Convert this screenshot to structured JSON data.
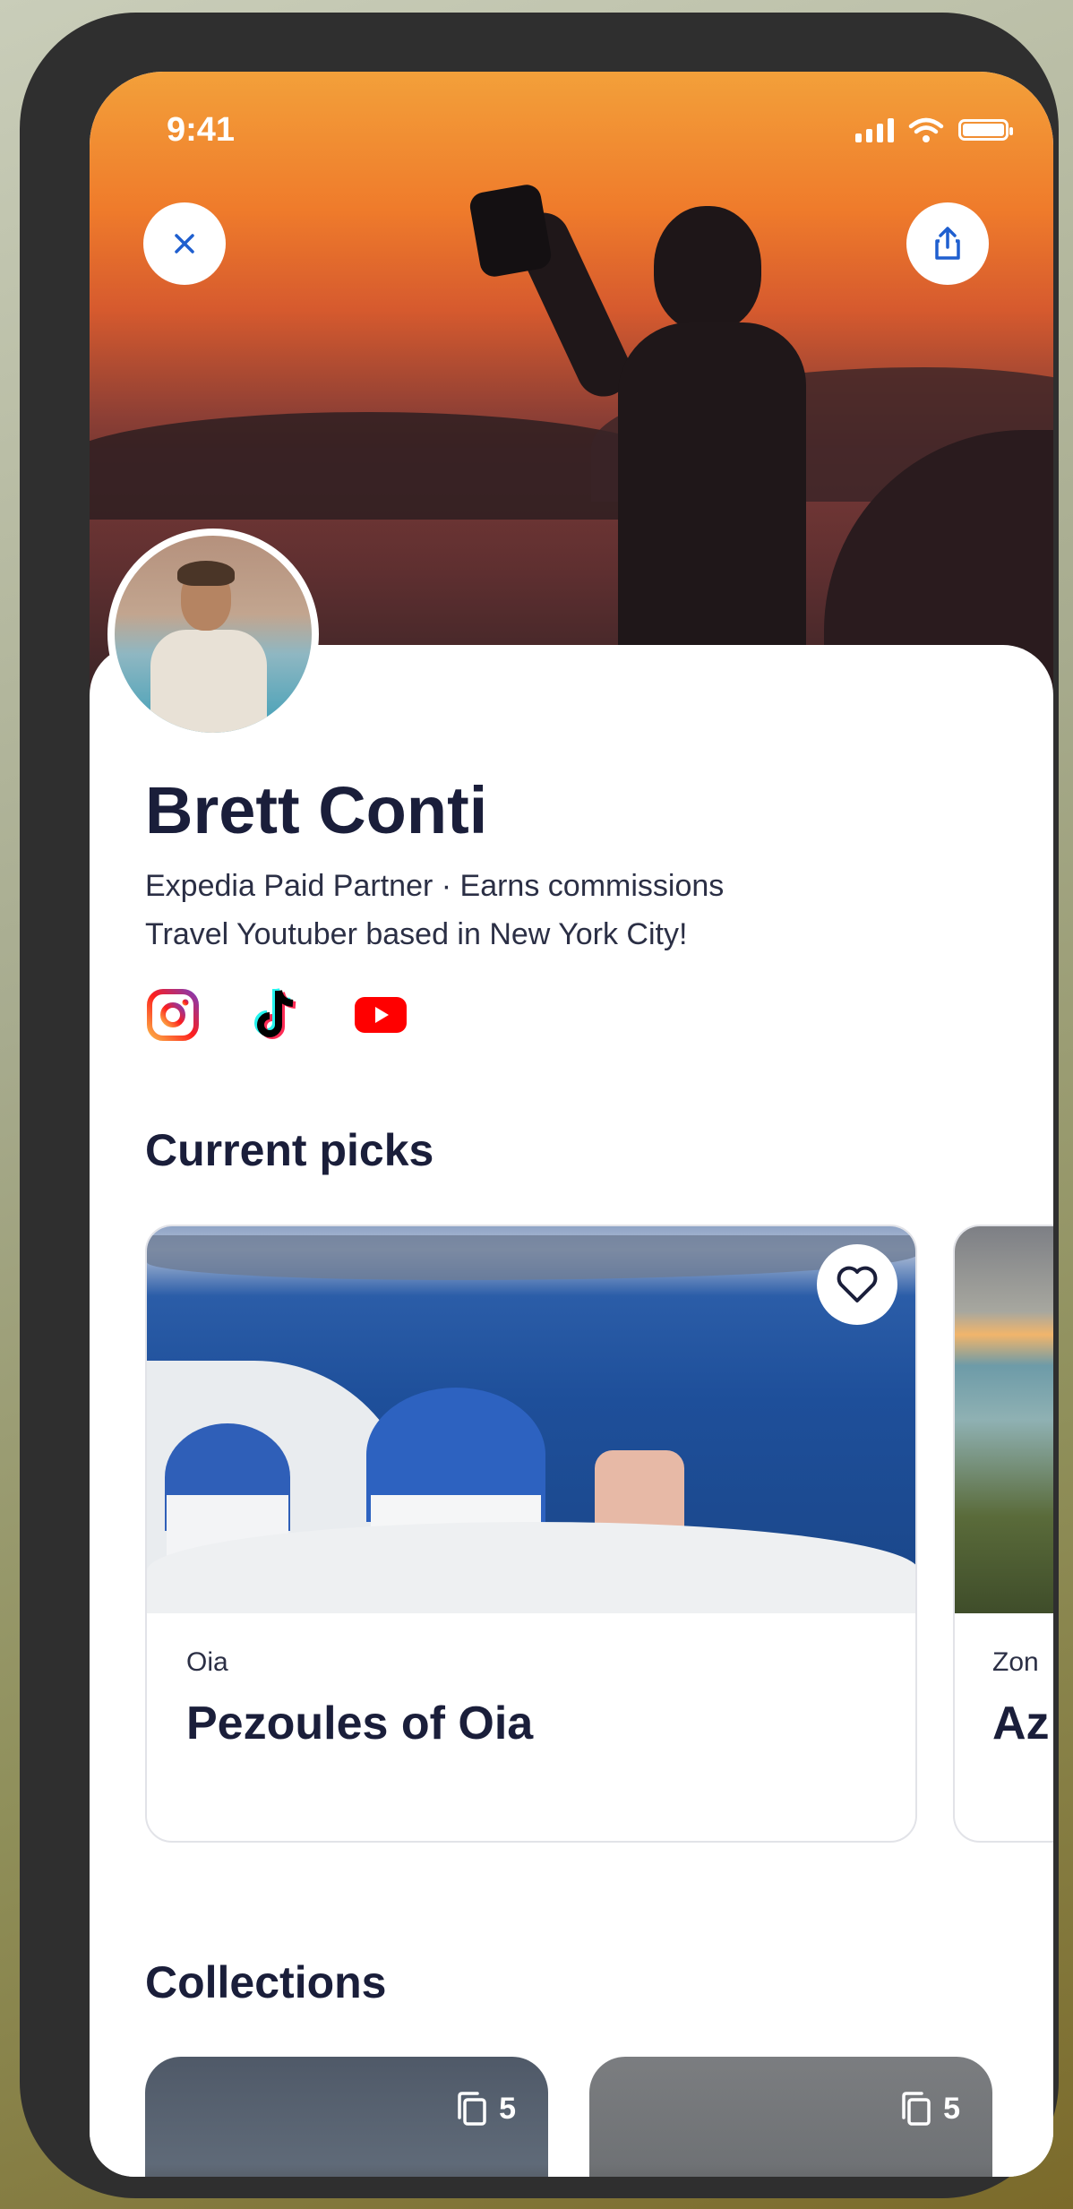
{
  "status_bar": {
    "time": "9:41"
  },
  "header": {
    "close_icon": "close-icon",
    "share_icon": "share-icon"
  },
  "profile": {
    "name": "Brett Conti",
    "partner_line": "Expedia Paid Partner · Earns commissions",
    "bio": "Travel Youtuber based in New York City!",
    "socials": [
      "instagram-icon",
      "tiktok-icon",
      "youtube-icon"
    ]
  },
  "current_picks": {
    "title": "Current picks",
    "cards": [
      {
        "location": "Oia",
        "title": "Pezoules of Oia"
      },
      {
        "location": "Zon",
        "title": "Az"
      }
    ]
  },
  "collections": {
    "title": "Collections",
    "items": [
      {
        "count": "5"
      },
      {
        "count": "5"
      }
    ]
  },
  "colors": {
    "heading": "#1a1e3a",
    "accent_blue": "#1f5fcf",
    "youtube": "#ff0000"
  }
}
